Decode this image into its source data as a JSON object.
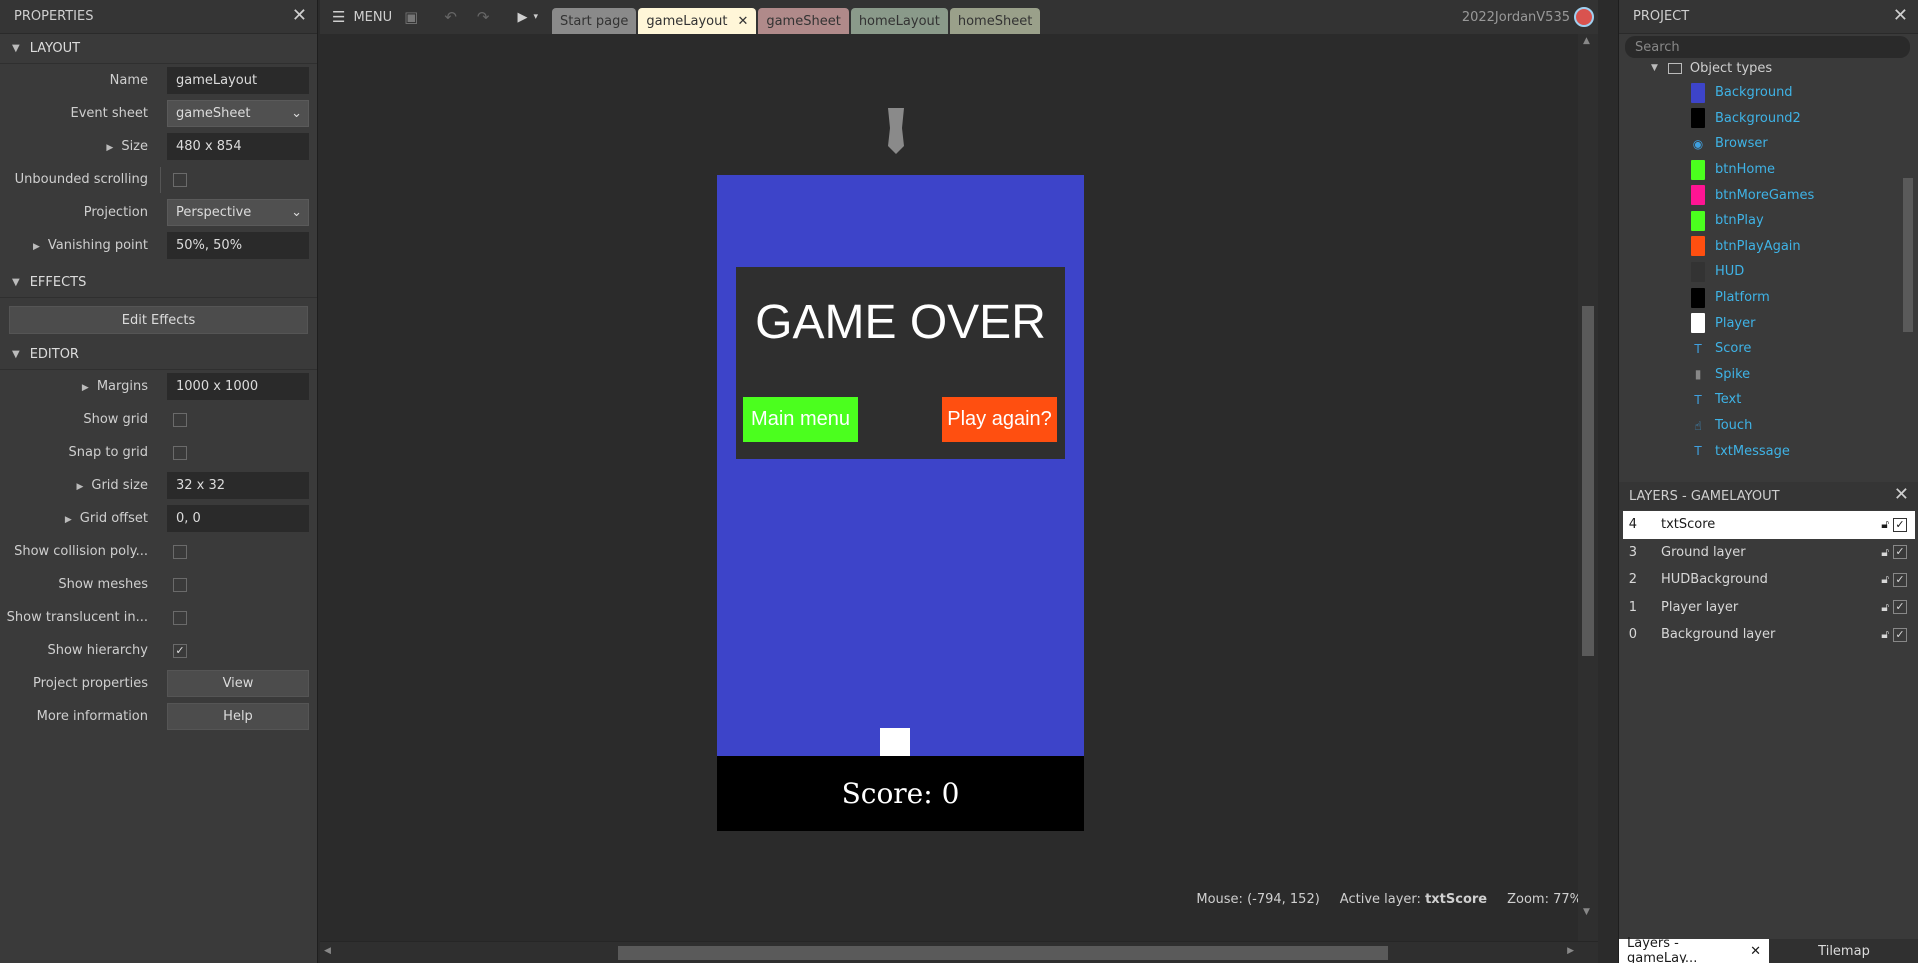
{
  "properties": {
    "title": "PROPERTIES",
    "sections": {
      "layout": "LAYOUT",
      "effects": "EFFECTS",
      "editor": "EDITOR"
    },
    "layout": {
      "name_label": "Name",
      "name_value": "gameLayout",
      "event_sheet_label": "Event sheet",
      "event_sheet_value": "gameSheet",
      "size_label": "Size",
      "size_value": "480 x 854",
      "unbounded_label": "Unbounded scrolling",
      "unbounded_checked": false,
      "projection_label": "Projection",
      "projection_value": "Perspective",
      "vanishing_label": "Vanishing point",
      "vanishing_value": "50%, 50%"
    },
    "effects": {
      "edit_label": "Edit Effects"
    },
    "editor": {
      "margins_label": "Margins",
      "margins_value": "1000 x 1000",
      "show_grid_label": "Show grid",
      "show_grid_checked": false,
      "snap_label": "Snap to grid",
      "snap_checked": false,
      "grid_size_label": "Grid size",
      "grid_size_value": "32 x 32",
      "grid_offset_label": "Grid offset",
      "grid_offset_value": "0, 0",
      "collision_label": "Show collision poly...",
      "collision_checked": false,
      "meshes_label": "Show meshes",
      "meshes_checked": false,
      "translucent_label": "Show translucent in...",
      "translucent_checked": false,
      "hierarchy_label": "Show hierarchy",
      "hierarchy_checked": true,
      "project_props_label": "Project properties",
      "project_props_btn": "View",
      "more_info_label": "More information",
      "more_info_btn": "Help"
    }
  },
  "toolbar": {
    "menu_label": "MENU",
    "tabs": [
      {
        "label": "Start page",
        "color": "#8a8a8a",
        "active": false
      },
      {
        "label": "gameLayout",
        "color": "#fff6d8",
        "active": true
      },
      {
        "label": "gameSheet",
        "color": "#b08a8a",
        "active": false
      },
      {
        "label": "homeLayout",
        "color": "#8a9a8a",
        "active": false
      },
      {
        "label": "homeSheet",
        "color": "#9aa08a",
        "active": false
      }
    ],
    "user": "2022JordanV535"
  },
  "layout_view": {
    "gameover_text": "GAME OVER",
    "main_menu_label": "Main menu",
    "play_again_label": "Play again?",
    "score_text": "Score: 0",
    "colors": {
      "background": "#3d44c9",
      "main_menu": "#4bff1e",
      "play_again": "#ff4f10",
      "panel": "#2f2f2f"
    }
  },
  "status": {
    "mouse": "Mouse: (-794, 152)",
    "active_layer_label": "Active layer:",
    "active_layer_value": "txtScore",
    "zoom": "Zoom: 77%"
  },
  "project": {
    "title": "PROJECT",
    "search_placeholder": "Search",
    "folder": "Object types",
    "items": [
      {
        "name": "Background",
        "icon": "swatch",
        "color": "#3d44c9"
      },
      {
        "name": "Background2",
        "icon": "swatch",
        "color": "#000000"
      },
      {
        "name": "Browser",
        "icon": "globe-icon",
        "color": "#3fa0e0"
      },
      {
        "name": "btnHome",
        "icon": "swatch",
        "color": "#4bff1e"
      },
      {
        "name": "btnMoreGames",
        "icon": "swatch",
        "color": "#ff1493"
      },
      {
        "name": "btnPlay",
        "icon": "swatch",
        "color": "#4bff1e"
      },
      {
        "name": "btnPlayAgain",
        "icon": "swatch",
        "color": "#ff4f10"
      },
      {
        "name": "HUD",
        "icon": "swatch",
        "color": "#333333"
      },
      {
        "name": "Platform",
        "icon": "swatch",
        "color": "#000000"
      },
      {
        "name": "Player",
        "icon": "swatch",
        "color": "#ffffff"
      },
      {
        "name": "Score",
        "icon": "text-icon",
        "color": "#3fa0e0"
      },
      {
        "name": "Spike",
        "icon": "spike-icon",
        "color": "#888888"
      },
      {
        "name": "Text",
        "icon": "text-icon",
        "color": "#3fa0e0"
      },
      {
        "name": "Touch",
        "icon": "touch-icon",
        "color": "#3fa0e0"
      },
      {
        "name": "txtMessage",
        "icon": "text-icon",
        "color": "#3fa0e0"
      }
    ]
  },
  "layers": {
    "title": "LAYERS - GAMELAYOUT",
    "rows": [
      {
        "num": "4",
        "name": "txtScore",
        "selected": true
      },
      {
        "num": "3",
        "name": "Ground layer",
        "selected": false
      },
      {
        "num": "2",
        "name": "HUDBackground",
        "selected": false
      },
      {
        "num": "1",
        "name": "Player layer",
        "selected": false
      },
      {
        "num": "0",
        "name": "Background layer",
        "selected": false
      }
    ]
  },
  "bottom_tabs": {
    "layers_tab": "Layers - gameLay...",
    "tilemap_tab": "Tilemap"
  }
}
